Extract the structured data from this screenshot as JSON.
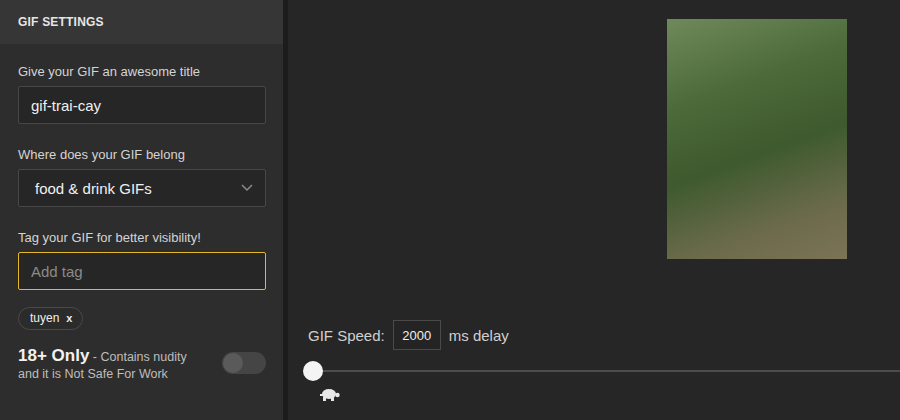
{
  "panel": {
    "title": "GIF SETTINGS"
  },
  "fields": [
    {
      "label": "Give your GIF an awesome title",
      "kind": "text",
      "value": "gif-trai-cay"
    },
    {
      "label": "Where does your GIF belong",
      "kind": "select",
      "value": "food & drink GIFs"
    },
    {
      "label": "Tag your GIF for better visibility!",
      "kind": "tag",
      "placeholder": "Add tag",
      "focused": true
    }
  ],
  "tags": [
    {
      "label": "tuyen",
      "remove": "x"
    }
  ],
  "nsfw": {
    "title": "18+ Only",
    "description": "- Contains nudity and it is Not Safe For Work",
    "on": false
  },
  "speed": {
    "label": "GIF Speed:",
    "value": "2000",
    "unit": "ms delay",
    "level": 0
  }
}
